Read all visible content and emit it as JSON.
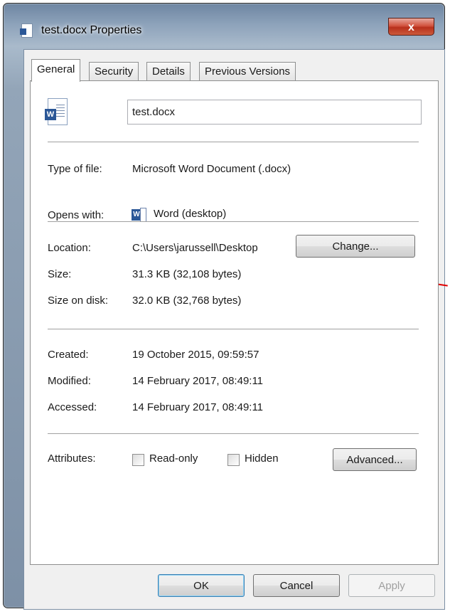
{
  "window": {
    "title": "test.docx Properties",
    "close_label": "x"
  },
  "tabs": [
    {
      "label": "General",
      "active": true
    },
    {
      "label": "Security",
      "active": false
    },
    {
      "label": "Details",
      "active": false
    },
    {
      "label": "Previous Versions",
      "active": false
    }
  ],
  "general": {
    "file_name": "test.docx",
    "type_label": "Type of file:",
    "type_value": "Microsoft Word Document (.docx)",
    "opens_label": "Opens with:",
    "opens_value": "Word (desktop)",
    "change_button": "Change...",
    "location_label": "Location:",
    "location_value": "C:\\Users\\jarussell\\Desktop",
    "size_label": "Size:",
    "size_value": "31.3 KB (32,108 bytes)",
    "size_on_disk_label": "Size on disk:",
    "size_on_disk_value": "32.0 KB (32,768 bytes)",
    "created_label": "Created:",
    "created_value": "19 October 2015, 09:59:57",
    "modified_label": "Modified:",
    "modified_value": "14 February 2017, 08:49:11",
    "accessed_label": "Accessed:",
    "accessed_value": "14 February 2017, 08:49:11",
    "attributes_label": "Attributes:",
    "readonly_label": "Read-only",
    "readonly_checked": false,
    "hidden_label": "Hidden",
    "hidden_checked": false,
    "advanced_button": "Advanced..."
  },
  "footer": {
    "ok": "OK",
    "cancel": "Cancel",
    "apply": "Apply"
  },
  "colors": {
    "annotation_arrow": "#e00000",
    "word_blue": "#2b5797",
    "close_red": "#c7432d"
  },
  "icons": {
    "title": "document-icon",
    "file": "word-document-icon",
    "app": "word-app-icon",
    "close": "close-icon"
  }
}
